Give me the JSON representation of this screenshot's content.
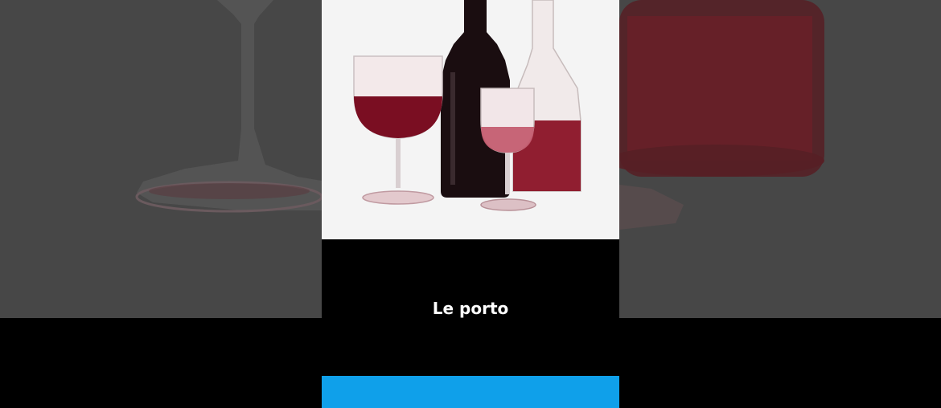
{
  "card": {
    "caption": "Le porto"
  },
  "colors": {
    "background_dim": "#474747",
    "card_background": "#000000",
    "image_background": "#f4f4f4",
    "accent": "#0fa0ea",
    "wine": "#7a0e22"
  },
  "icons": [
    "wine-glass-illustration",
    "wine-bottle-illustration",
    "decanter-illustration"
  ]
}
